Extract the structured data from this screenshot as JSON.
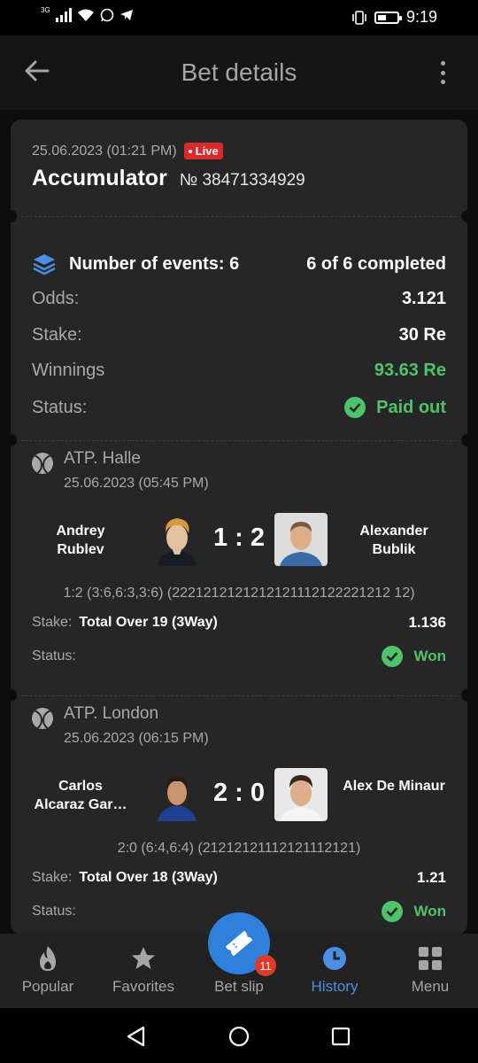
{
  "status_bar": {
    "network": "3G",
    "time": "9:19"
  },
  "app_bar": {
    "title": "Bet details"
  },
  "bet": {
    "datetime": "25.06.2023 (01:21 PM)",
    "live_label": "Live",
    "type": "Accumulator",
    "number": "№ 38471334929",
    "events_label": "Number of events: 6",
    "completed": "6 of 6 completed",
    "odds_label": "Odds:",
    "odds_value": "3.121",
    "stake_label": "Stake:",
    "stake_value": "30 Re",
    "winnings_label": "Winnings",
    "winnings_value": "93.63 Re",
    "status_label": "Status:",
    "status_value": "Paid out"
  },
  "events": [
    {
      "league": "ATP. Halle",
      "date": "25.06.2023 (05:45 PM)",
      "player1": "Andrey Rublev",
      "player2": "Alexander Bublik",
      "score": "1 : 2",
      "detail": "1:2 (3:6,6:3,3:6) (2221212121212121112122221212 12)",
      "stake_label": "Stake:",
      "market": "Total Over 19 (3Way)",
      "odd": "1.136",
      "status_label": "Status:",
      "result": "Won"
    },
    {
      "league": "ATP. London",
      "date": "25.06.2023 (06:15 PM)",
      "player1": "Carlos Alcaraz Gar…",
      "player2": "Alex De Minaur",
      "score": "2 : 0",
      "detail": "2:0 (6:4,6:4) (21212121112121112121)",
      "stake_label": "Stake:",
      "market": "Total Over 18 (3Way)",
      "odd": "1.21",
      "status_label": "Status:",
      "result": "Won"
    }
  ],
  "bottom_nav": {
    "popular": "Popular",
    "favorites": "Favorites",
    "bet_slip": "Bet slip",
    "bet_slip_count": "11",
    "history": "History",
    "menu": "Menu"
  },
  "colors": {
    "accent": "#2f7fdc",
    "success": "#4fc36a",
    "live": "#d82a2a"
  }
}
